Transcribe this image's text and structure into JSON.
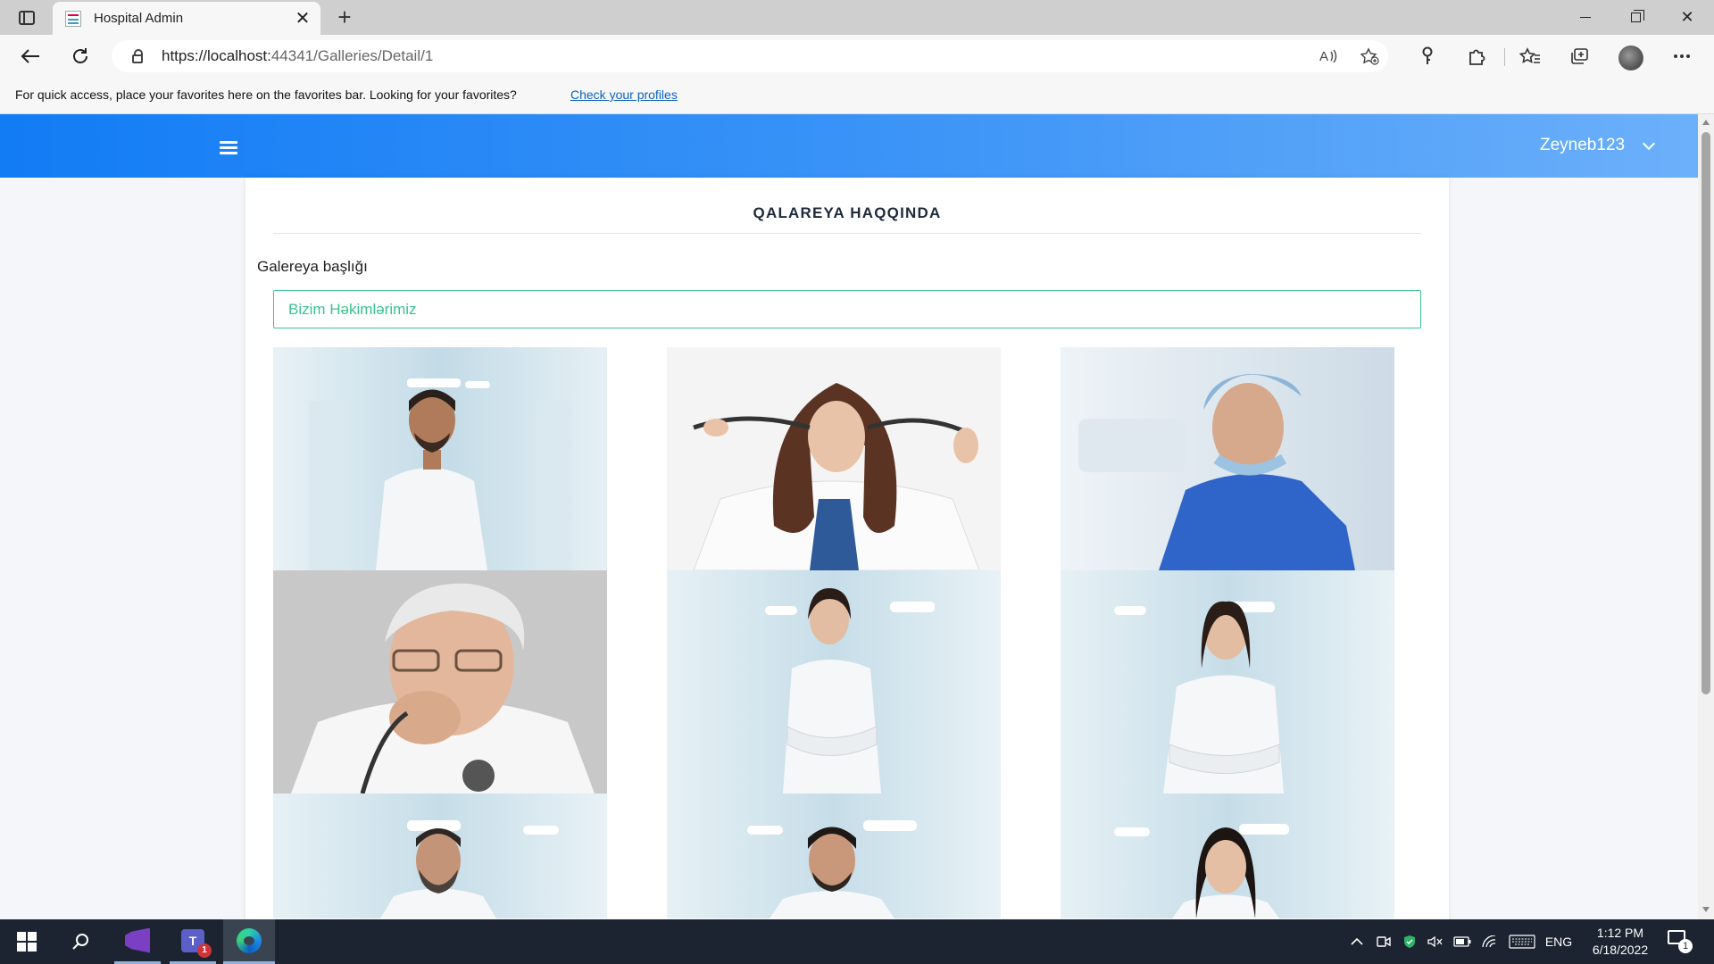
{
  "browser": {
    "tab_title": "Hospital Admin",
    "url_host": "https://localhost:",
    "url_rest": "44341/Galleries/Detail/1",
    "new_tab_symbol": "+",
    "close_symbol": "✕"
  },
  "favorites_bar": {
    "message": "For quick access, place your favorites here on the favorites bar. Looking for your favorites?",
    "link": "Check your profiles"
  },
  "header": {
    "user_name": "Zeyneb123"
  },
  "card": {
    "title": "QALAREYA HAQQINDA",
    "field_label": "Galereya başlığı",
    "field_value": "Bizim Həkimlərimiz"
  },
  "gallery": {
    "images": [
      {
        "subject": "male-doctor-hallway",
        "bg": "#d5e6ee"
      },
      {
        "subject": "female-doctor-stethoscope",
        "bg": "#f3f3f3"
      },
      {
        "subject": "surgeon-blue-scrubs",
        "bg": "#dce7ef"
      },
      {
        "subject": "elderly-doctor-glasses",
        "bg": "#c9c9c9"
      },
      {
        "subject": "female-doctor-arms-crossed",
        "bg": "#d3e7f0"
      },
      {
        "subject": "female-doctor-hallway",
        "bg": "#d3e7f0"
      },
      {
        "subject": "male-doctor-beard",
        "bg": "#d3e7f0"
      },
      {
        "subject": "male-doctor-portrait",
        "bg": "#d3e7f0"
      },
      {
        "subject": "female-doctor-portrait",
        "bg": "#d3e7f0"
      }
    ]
  },
  "taskbar": {
    "time": "1:12 PM",
    "date": "6/18/2022",
    "language": "ENG",
    "teams_badge": "1",
    "notification_count": "1",
    "teams_letter": "T"
  },
  "colors": {
    "header_start": "#127cf5",
    "header_end": "#6cb0fa",
    "input_accent": "#3ac48f",
    "link": "#0b62c4"
  }
}
